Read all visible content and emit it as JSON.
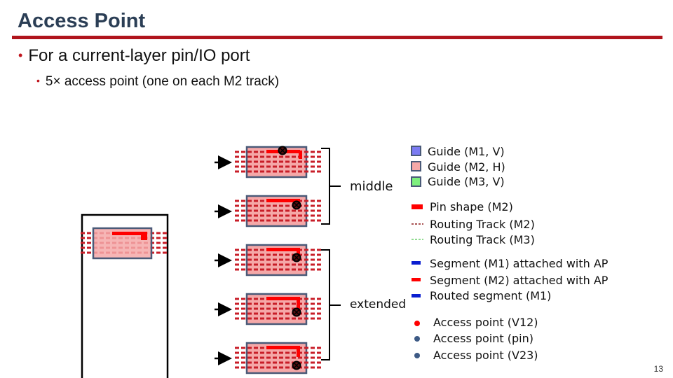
{
  "slide": {
    "title": "Access Point",
    "bullet1": "For a current-layer pin/IO port",
    "bullet2": "5× access point (one on each M2 track)",
    "page_number": "13"
  },
  "groups": {
    "middle": "middle",
    "extended": "extended"
  },
  "colors": {
    "title": "#2b3e55",
    "accent_rule": "#b0141c",
    "guide_m1": "#7b7bf2",
    "guide_m2": "#f5a8a8",
    "guide_m3": "#7ef07e",
    "guide_border": "#4a5a78",
    "pin_shape": "#ff0000",
    "track_m2": "#c81e28",
    "track_m3": "#6ccf6c",
    "segment_m1": "#0a1ed0",
    "access_point_v12": "#ff0000",
    "access_point_other": "#3d5a85"
  },
  "legend": {
    "guides": [
      {
        "label": "Guide (M1, V)",
        "icon": "guide-m1-swatch"
      },
      {
        "label": "Guide (M2, H)",
        "icon": "guide-m2-swatch"
      },
      {
        "label": "Guide (M3, V)",
        "icon": "guide-m3-swatch"
      }
    ],
    "shapes": [
      {
        "label": "Pin shape (M2)",
        "icon": "pin-shape-swatch"
      },
      {
        "label": "Routing Track (M2)",
        "icon": "track-m2-dashes"
      },
      {
        "label": "Routing Track (M3)",
        "icon": "track-m3-dashes"
      }
    ],
    "segments": [
      {
        "label": "Segment (M1) attached with AP",
        "icon": "segment-m1-swatch"
      },
      {
        "label": "Segment (M2) attached with AP",
        "icon": "segment-m2-swatch"
      },
      {
        "label": "Routed segment (M1)",
        "icon": "routed-m1-swatch"
      }
    ],
    "access_points": [
      {
        "label": "Access point (V12)",
        "icon": "ap-v12-dot"
      },
      {
        "label": "Access point (pin)",
        "icon": "ap-pin-dot"
      },
      {
        "label": "Access point (V23)",
        "icon": "ap-v23-dot"
      }
    ]
  }
}
